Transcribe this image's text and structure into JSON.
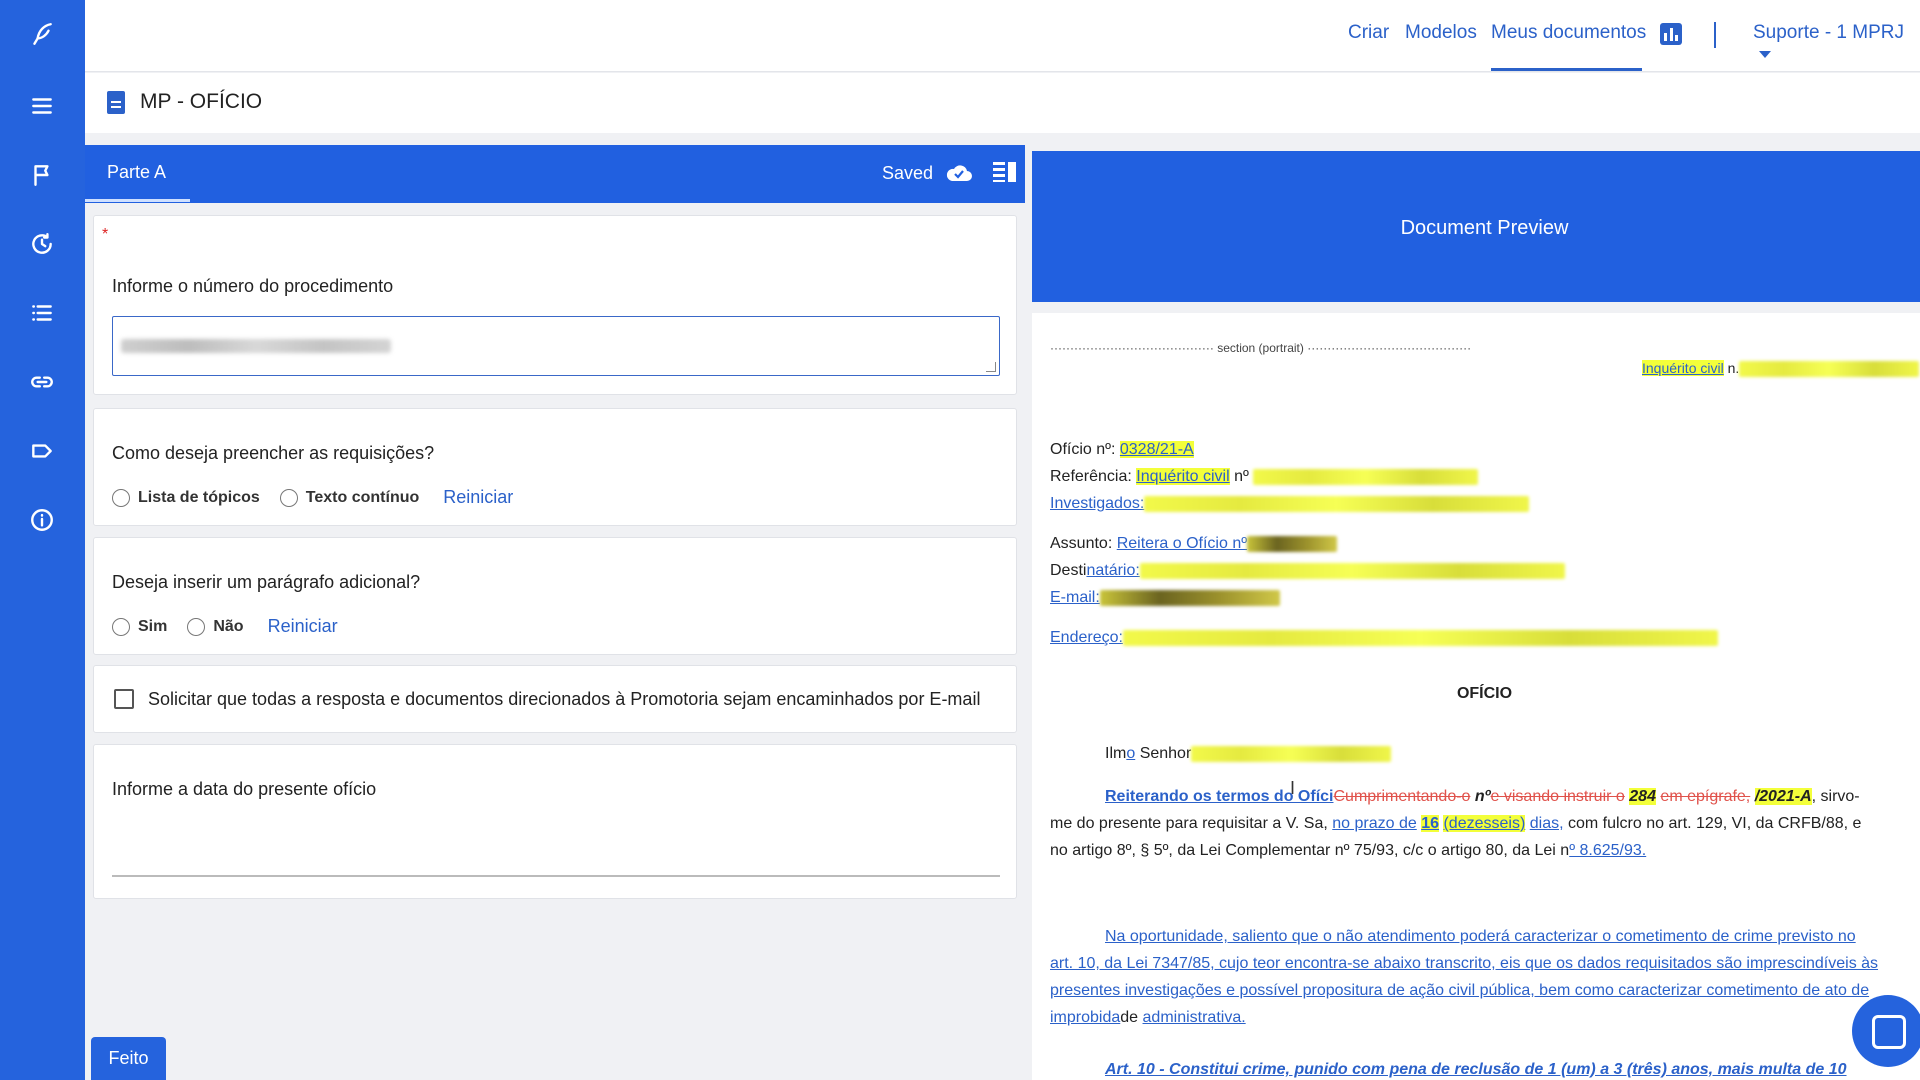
{
  "topnav": {
    "criar": "Criar",
    "modelos": "Modelos",
    "meus_documentos": "Meus documentos",
    "user": "Suporte - 1 MPRJ"
  },
  "page": {
    "title": "MP - OFÍCIO"
  },
  "colors": {
    "primary": "#2563dd",
    "link": "#2b61c9",
    "highlight": "#f3ff3a",
    "deleted": "#e0524b"
  },
  "form": {
    "tab": "Parte A",
    "status": "Saved",
    "required_mark": "*",
    "q_numero": "Informe o número do procedimento",
    "q_requisicoes": "Como deseja preencher as requisições?",
    "opt_lista": "Lista de tópicos",
    "opt_texto": "Texto contínuo",
    "reset": "Reiniciar",
    "q_paragrafo": "Deseja inserir um parágrafo adicional?",
    "opt_sim": "Sim",
    "opt_nao": "Não",
    "check_email": "Solicitar que todas a resposta e documentos direcionados à Promotoria sejam encaminhados por E-mail",
    "q_data": "Informe a data do presente ofício",
    "done": "Feito"
  },
  "preview": {
    "header": "Document Preview",
    "section": "section (portrait)",
    "ic_label": "Inquérito civil",
    "ic_suffix": "n.",
    "oficio_label": "Ofício nº:",
    "oficio_num": "0328/21-A",
    "ref_label": "Referência:",
    "ref_value": "Inquérito civil",
    "ref_no": "nº",
    "invest": "Investigados:",
    "assunto_label": "Assunto:",
    "assunto_value": "Reitera o Ofício nº",
    "dest_a": "Desti",
    "dest_b": "natário:",
    "email": "E-mail:",
    "endereco": "Endereço:",
    "heading": "OFÍCIO",
    "salut_a": "Ilm",
    "salut_b": "o",
    "salut_c": "Senhor",
    "p1_a": "Reiterando os termos do Ofíci",
    "p1_del1": "Cumprimentando-o",
    "p1_no": "nº",
    "p1_del2": "e visando instruir  o",
    "p1_num": "284",
    "p1_del3": "em epígrafe,",
    "p1_year": "/2021-A",
    "p1_tail": ", sirvo-",
    "p2_a": "me do presente para requisitar a V. Sa,",
    "p2_link": "no prazo de",
    "p2_days": "16",
    "p2_days_txt": "(dezesseis)",
    "p2_dias": "dias,",
    "p2_b": "com fulcro no art. 129, VI, da CRFB/88, e",
    "p3_a": "no artigo 8º, § 5º, da Lei Complementar nº 75/93, c/c o artigo 80, da Lei n",
    "p3_link": "º 8.625/93.",
    "p4_1": "Na oportunidade, saliento que o não atendimento poderá caracterizar o cometimento de crime previsto no",
    "p4_2": "art. 10, da Lei 7347/85, cujo teor encontra-se abaixo transcrito, eis que os dados requisitados são imprescindíveis às",
    "p4_3": "presentes investigações e possível propositura de ação civil pública, bem como caracterizar cometimento de ato de",
    "p4_4a": "improbida",
    "p4_4b": "de",
    "p4_4c": "administrativa.",
    "p5": "Art. 10 - Constitui crime, punido com pena de reclusão de 1 (um) a 3 (três) anos, mais multa de 10"
  }
}
